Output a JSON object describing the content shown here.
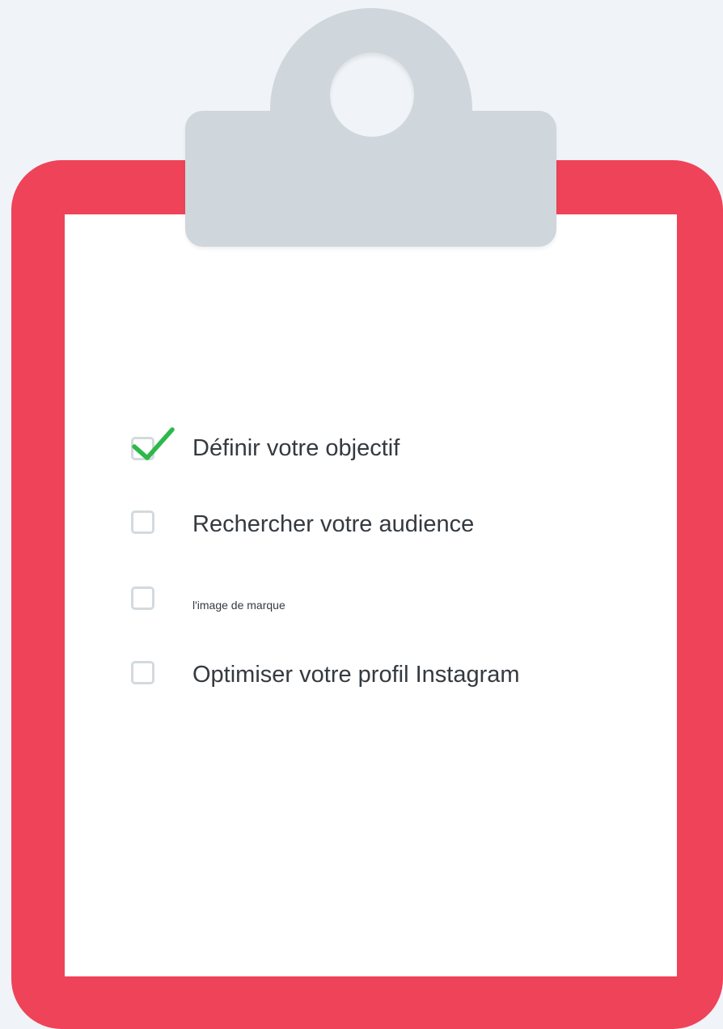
{
  "checklist": {
    "items": [
      {
        "label": "Définir votre objectif",
        "checked": true
      },
      {
        "label": "Rechercher votre audience",
        "checked": false
      },
      {
        "label": "l'image de marque",
        "checked": false
      },
      {
        "label": "Optimiser votre profil Instagram",
        "checked": false
      }
    ]
  },
  "colors": {
    "board": "#ee4359",
    "paper": "#ffffff",
    "clip": "#cfd6dc",
    "checkbox_border": "#d3dade",
    "checkmark": "#2db84b",
    "text": "#343a40"
  },
  "icons": {
    "check": "checkmark-icon",
    "clip": "clipboard-clip-icon"
  }
}
